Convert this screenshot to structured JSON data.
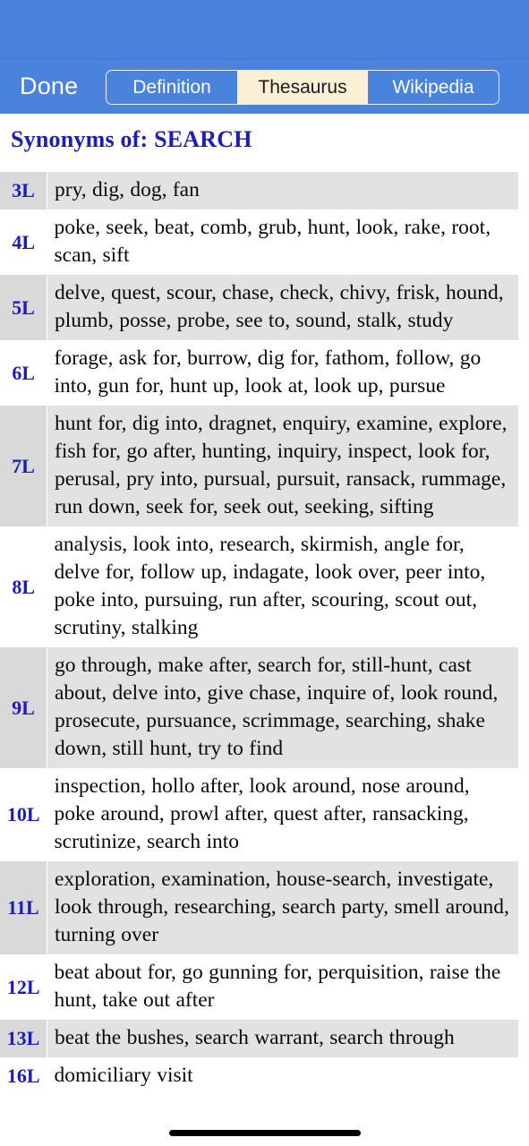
{
  "status_bar": {},
  "nav_bar": {
    "done_label": "Done",
    "segments": [
      {
        "label": "Definition",
        "selected": false
      },
      {
        "label": "Thesaurus",
        "selected": true
      },
      {
        "label": "Wikipedia",
        "selected": false
      }
    ]
  },
  "heading": "Synonyms of: SEARCH",
  "colors": {
    "nav_blue": "#4a83dd",
    "selected_segment": "#fbf0d6",
    "heading_navy": "#1d1db6",
    "row_shaded": "#e2e2e2",
    "label_shaded": "#d9d9d9"
  },
  "table": {
    "rows": [
      {
        "length": "3L",
        "words": "pry, dig, dog, fan",
        "shaded": true
      },
      {
        "length": "4L",
        "words": "poke, seek, beat, comb, grub, hunt, look, rake, root, scan, sift",
        "shaded": false
      },
      {
        "length": "5L",
        "words": "delve, quest, scour, chase, check, chivy, frisk, hound, plumb, posse, probe, see to, sound, stalk, study",
        "shaded": true
      },
      {
        "length": "6L",
        "words": "forage, ask for, burrow, dig for, fathom, follow, go into, gun for, hunt up, look at, look up, pursue",
        "shaded": false
      },
      {
        "length": "7L",
        "words": "hunt for, dig into, dragnet, enquiry, examine, explore, fish for, go after, hunting, inquiry, inspect, look for, perusal, pry into, pursual, pursuit, ransack, rummage, run down, seek for, seek out, seeking, sifting",
        "shaded": true
      },
      {
        "length": "8L",
        "words": "analysis, look into, research, skirmish, angle for, delve for, follow up, indagate, look over, peer into, poke into, pursuing, run after, scouring, scout out, scrutiny, stalking",
        "shaded": false
      },
      {
        "length": "9L",
        "words": "go through, make after, search for, still-hunt, cast about, delve into, give chase, inquire of, look round, prosecute, pursuance, scrimmage, searching, shake down, still hunt, try to find",
        "shaded": true
      },
      {
        "length": "10L",
        "words": "inspection, hollo after, look around, nose around, poke around, prowl after, quest after, ransacking, scrutinize, search into",
        "shaded": false
      },
      {
        "length": "11L",
        "words": "exploration, examination, house-search, investigate, look through, researching, search party, smell around, turning over",
        "shaded": true
      },
      {
        "length": "12L",
        "words": "beat about for, go gunning for, perquisition, raise the hunt, take out after",
        "shaded": false
      },
      {
        "length": "13L",
        "words": "beat the bushes, search warrant, search through",
        "shaded": true
      },
      {
        "length": "16L",
        "words": "domiciliary visit",
        "shaded": false
      }
    ]
  }
}
